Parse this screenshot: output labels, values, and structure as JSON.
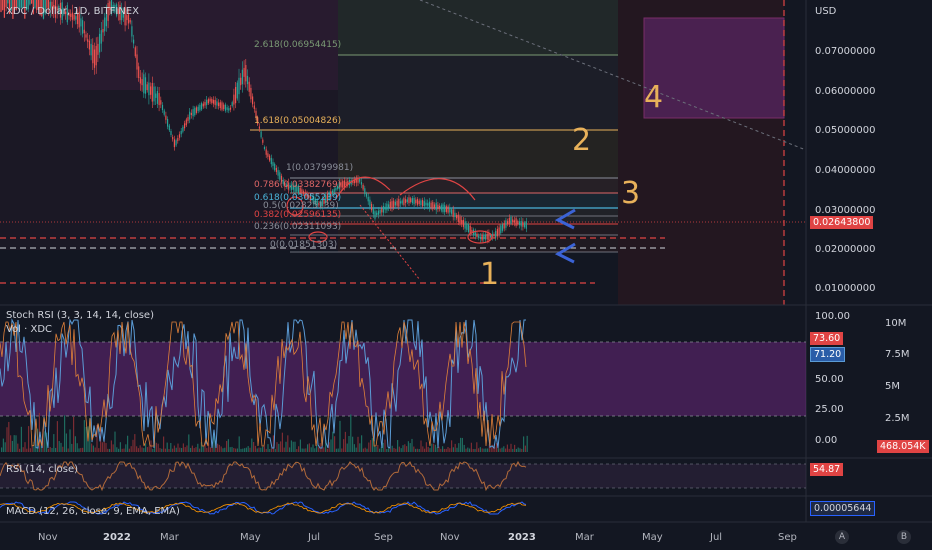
{
  "header": {
    "symbol_title": "XDC / Dollar, 1D, BITFINEX",
    "currency": "USD"
  },
  "price_axis": [
    "0.07000000",
    "0.06000000",
    "0.05000000",
    "0.04000000",
    "0.03000000",
    "0.02000000",
    "0.01000000"
  ],
  "last_price": "0.02643800",
  "fib_levels": [
    {
      "label": "2.618(0.06954415)",
      "color": "#7a9a74"
    },
    {
      "label": "1.618(0.05004826)",
      "color": "#e8b15a"
    },
    {
      "label": "1(0.03799981)",
      "color": "#8a8e99"
    },
    {
      "label": "0.786(0.03382769)",
      "color": "#d66"
    },
    {
      "label": "0.618(0.03055239)",
      "color": "#4ab3d9"
    },
    {
      "label": "0.5(0.02825139)",
      "color": "#8a8e99"
    },
    {
      "label": "0.382(0.02596135)",
      "color": "#e04444"
    },
    {
      "label": "0.236(0.02311093)",
      "color": "#8a8e99"
    },
    {
      "label": "0(0.01851303)",
      "color": "#8a8e99"
    }
  ],
  "annotations": [
    "1",
    "2",
    "3",
    "4"
  ],
  "stoch_rsi": {
    "title": "Stoch RSI (3, 3, 14, 14, close)",
    "k": "73.60",
    "d": "71.20",
    "axis": [
      "100.00",
      "75.00",
      "50.00",
      "25.00",
      "0.00"
    ]
  },
  "volume": {
    "title": "Vol · XDC",
    "value": "468.054K",
    "axis": [
      "10M",
      "7.5M",
      "5M",
      "2.5M"
    ]
  },
  "rsi": {
    "title": "RSI (14, close)",
    "value": "54.87"
  },
  "macd": {
    "title": "MACD (12, 26, close, 9, EMA, EMA)",
    "value": "0.00005644"
  },
  "time_axis": [
    {
      "label": "Nov",
      "bold": false
    },
    {
      "label": "2022",
      "bold": true
    },
    {
      "label": "Mar",
      "bold": false
    },
    {
      "label": "May",
      "bold": false
    },
    {
      "label": "Jul",
      "bold": false
    },
    {
      "label": "Sep",
      "bold": false
    },
    {
      "label": "Nov",
      "bold": false
    },
    {
      "label": "2023",
      "bold": true
    },
    {
      "label": "Mar",
      "bold": false
    },
    {
      "label": "May",
      "bold": false
    },
    {
      "label": "Jul",
      "bold": false
    },
    {
      "label": "Sep",
      "bold": false
    }
  ],
  "corner_buttons": [
    "A",
    "B"
  ],
  "colors": {
    "up": "#26a69a",
    "down": "#ef5350",
    "accent": "#2962ff",
    "fib_gold": "#e8b15a",
    "purple": "#7b2a8f"
  }
}
